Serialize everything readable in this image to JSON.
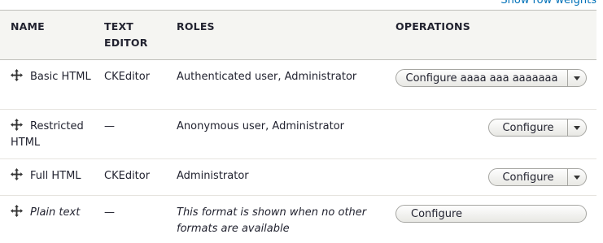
{
  "header_link": "Show row weights",
  "columns": {
    "name": "NAME",
    "text_editor": "TEXT EDITOR",
    "roles": "ROLES",
    "operations": "OPERATIONS"
  },
  "rows": [
    {
      "name": "Basic HTML",
      "editor": "CKEditor",
      "roles": "Authenticated user, Administrator",
      "operation": "Configure aaaa aaa aaaaaaa",
      "has_dropdown": true
    },
    {
      "name": "Restricted HTML",
      "editor": "—",
      "roles": "Anonymous user, Administrator",
      "operation": "Configure",
      "has_dropdown": true
    },
    {
      "name": "Full HTML",
      "editor": "CKEditor",
      "roles": "Administrator",
      "operation": "Configure",
      "has_dropdown": true
    },
    {
      "name": "Plain text",
      "editor": "—",
      "roles": "This format is shown when no other formats are available",
      "operation": "Configure",
      "has_dropdown": false
    }
  ],
  "colors": {
    "link": "#0071b8",
    "header_bg": "#f5f5f2",
    "border": "#bfbfba"
  },
  "icons": {
    "drag_handle": "drag-handle-icon",
    "dropdown_toggle": "chevron-down-icon"
  }
}
